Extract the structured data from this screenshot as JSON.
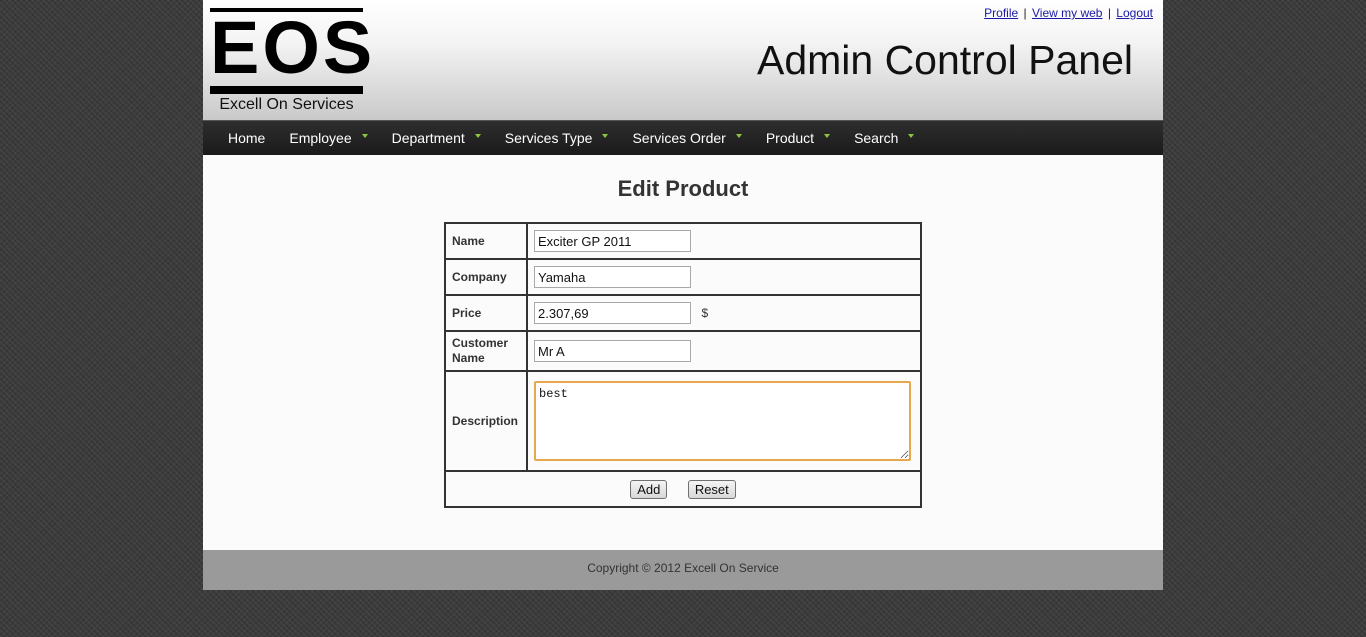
{
  "header": {
    "logo_letters": "EOS",
    "logo_tagline": "Excell On Services",
    "site_title": "Admin Control Panel",
    "links": {
      "profile": "Profile",
      "view_web": "View my web",
      "logout": "Logout",
      "separator": "|"
    }
  },
  "nav": {
    "items": [
      {
        "label": "Home",
        "has_dropdown": false
      },
      {
        "label": "Employee",
        "has_dropdown": true
      },
      {
        "label": "Department",
        "has_dropdown": true
      },
      {
        "label": "Services Type",
        "has_dropdown": true
      },
      {
        "label": "Services Order",
        "has_dropdown": true
      },
      {
        "label": "Product",
        "has_dropdown": true
      },
      {
        "label": "Search",
        "has_dropdown": true
      }
    ],
    "caret_color": "#8cc63e"
  },
  "main": {
    "heading": "Edit Product",
    "form": {
      "name_label": "Name",
      "name_value": "Exciter GP 2011",
      "company_label": "Company",
      "company_value": "Yamaha",
      "price_label": "Price",
      "price_value": "2.307,69",
      "price_unit": "$",
      "customer_label": "Customer Name",
      "customer_value": "Mr A",
      "description_label": "Description",
      "description_value": "best",
      "add_button": "Add",
      "reset_button": "Reset"
    }
  },
  "footer": {
    "copyright": "Copyright © 2012 Excell On Service"
  }
}
